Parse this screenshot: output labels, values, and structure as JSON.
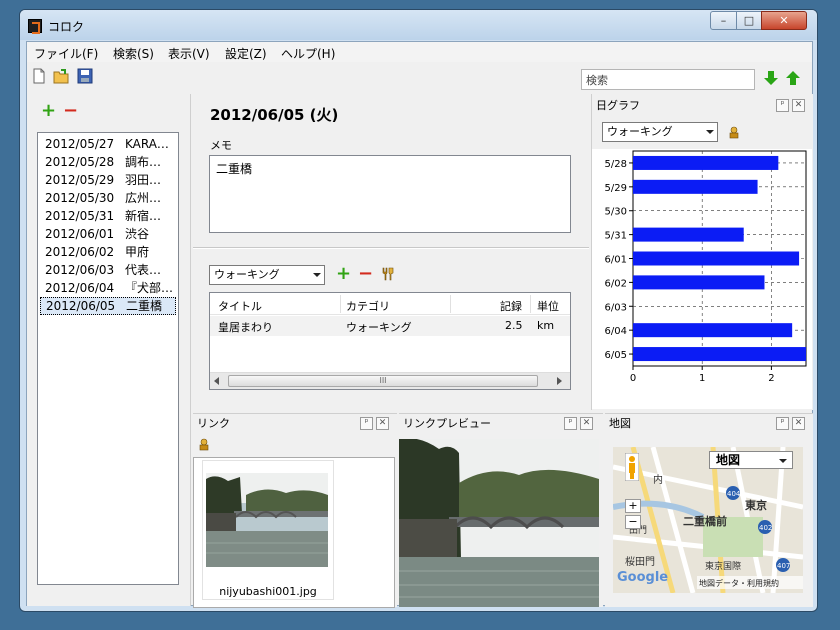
{
  "window": {
    "title": "コロク",
    "min_label": "–",
    "max_label": "□",
    "close_label": "✕"
  },
  "menu": [
    {
      "label": "ファイル(F)"
    },
    {
      "label": "検索(S)"
    },
    {
      "label": "表示(V)"
    },
    {
      "label": "設定(Z)"
    },
    {
      "label": "ヘルプ(H)"
    }
  ],
  "toolbar": {
    "icons": [
      "new-file-icon",
      "open-folder-icon",
      "save-disk-icon"
    ],
    "search_value": "検索",
    "down_icon": "green-down-arrow-icon",
    "up_icon": "green-up-arrow-icon"
  },
  "date_list": {
    "add_icon": "+",
    "remove_icon": "−",
    "items": [
      {
        "date": "2012/05/27",
        "memo": "KARA…"
      },
      {
        "date": "2012/05/28",
        "memo": "調布…"
      },
      {
        "date": "2012/05/29",
        "memo": "羽田…"
      },
      {
        "date": "2012/05/30",
        "memo": "広州…"
      },
      {
        "date": "2012/05/31",
        "memo": "新宿…"
      },
      {
        "date": "2012/06/01",
        "memo": "渋谷"
      },
      {
        "date": "2012/06/02",
        "memo": "甲府"
      },
      {
        "date": "2012/06/03",
        "memo": "代表…"
      },
      {
        "date": "2012/06/04",
        "memo": "『犬部…"
      },
      {
        "date": "2012/06/05",
        "memo": "二重橋"
      }
    ],
    "selected_index": 9
  },
  "detail": {
    "date_heading": "2012/06/05 (火)",
    "memo_label": "メモ",
    "memo_value": "二重橋",
    "category_select": "ウォーキング",
    "add_icon": "+",
    "remove_icon": "−",
    "table": {
      "columns": [
        "タイトル",
        "カテゴリ",
        "記録",
        "単位"
      ],
      "rows": [
        {
          "title": "皇居まわり",
          "category": "ウォーキング",
          "record": "2.5",
          "unit": "km"
        }
      ]
    },
    "scroll_grip": "III"
  },
  "graph_pane": {
    "title": "日グラフ",
    "pin": "ᵖ",
    "close": "✕",
    "select_value": "ウォーキング"
  },
  "chart_data": {
    "type": "bar",
    "orientation": "horizontal",
    "categories": [
      "5/28",
      "5/29",
      "5/30",
      "5/31",
      "6/01",
      "6/02",
      "6/03",
      "6/04",
      "6/05"
    ],
    "values": [
      2.1,
      1.8,
      0,
      1.6,
      2.4,
      1.9,
      0,
      2.3,
      2.5
    ],
    "xticks": [
      "0",
      "1",
      "2"
    ],
    "xlim": [
      0,
      2.5
    ],
    "bar_color": "#0b1cf5",
    "grid": true
  },
  "link_pane": {
    "title": "リンク",
    "pin": "ᵖ",
    "close": "✕",
    "thumbnail_filename": "nijyubashi001.jpg"
  },
  "preview_pane": {
    "title": "リンクプレビュー",
    "pin": "ᵖ",
    "close": "✕"
  },
  "map_pane": {
    "title": "地図",
    "pin": "ᵖ",
    "close": "✕",
    "map_type": "地図",
    "zoom_in": "+",
    "zoom_out": "−",
    "labels": {
      "l1": "二重橋前",
      "l2": "東京",
      "l3": "内",
      "l4": "東京国際",
      "l5": "桜田門",
      "l6": "田門",
      "r404": "404",
      "r402": "402",
      "r407": "407",
      "google": "Google",
      "footer": "地図データ・利用規約"
    }
  }
}
